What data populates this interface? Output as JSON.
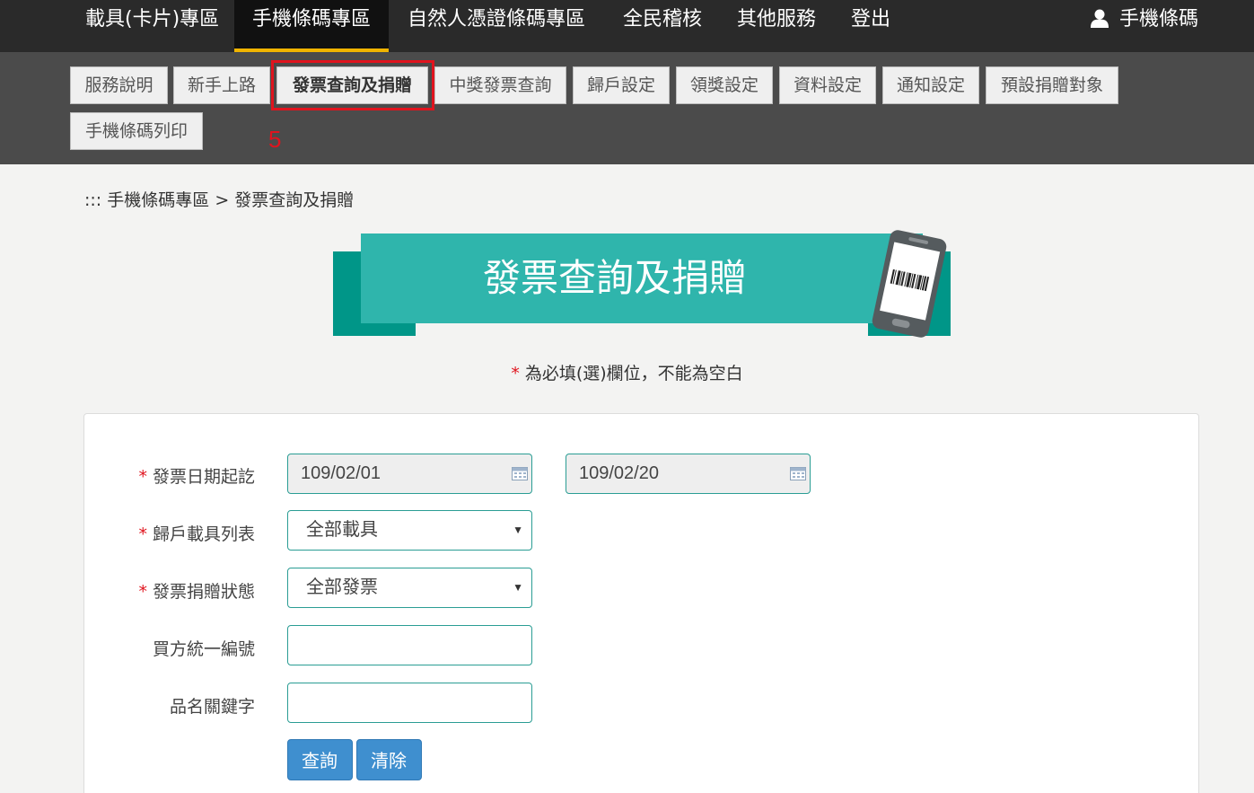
{
  "topnav": {
    "items": [
      {
        "label": "載具(卡片)專區"
      },
      {
        "label": "手機條碼專區"
      },
      {
        "label": "自然人憑證條碼專區"
      },
      {
        "label": "全民稽核"
      },
      {
        "label": "其他服務"
      },
      {
        "label": "登出"
      }
    ],
    "active_index": 1,
    "user_label": "手機條碼",
    "active_color": "#f0b400"
  },
  "subnav": {
    "items": [
      {
        "label": "服務說明"
      },
      {
        "label": "新手上路"
      },
      {
        "label": "發票查詢及捐贈"
      },
      {
        "label": "中獎發票查詢"
      },
      {
        "label": "歸戶設定"
      },
      {
        "label": "領獎設定"
      },
      {
        "label": "資料設定"
      },
      {
        "label": "通知設定"
      },
      {
        "label": "預設捐贈對象"
      },
      {
        "label": "手機條碼列印"
      }
    ],
    "active_index": 2
  },
  "annotation": {
    "step_number": "5",
    "color": "#e0141e"
  },
  "breadcrumb": {
    "prefix": ":::",
    "parent": "手機條碼專區",
    "separator": ">",
    "current": "發票查詢及捐贈"
  },
  "banner": {
    "title": "發票查詢及捐贈",
    "color": "#2fb5ac",
    "dark_color": "#009688"
  },
  "note": {
    "asterisk": "*",
    "text": "為必填(選)欄位，不能為空白"
  },
  "form": {
    "date_range": {
      "label": "發票日期起訖",
      "required": true,
      "start": "109/02/01",
      "end": "109/02/20"
    },
    "carrier_list": {
      "label": "歸戶載具列表",
      "required": true,
      "selected": "全部載具"
    },
    "donation_status": {
      "label": "發票捐贈狀態",
      "required": true,
      "selected": "全部發票"
    },
    "buyer_id": {
      "label": "買方統一編號",
      "value": ""
    },
    "item_keyword": {
      "label": "品名關鍵字",
      "value": ""
    },
    "query_label": "查詢",
    "clear_label": "清除",
    "button_color": "#3f8fcf"
  }
}
